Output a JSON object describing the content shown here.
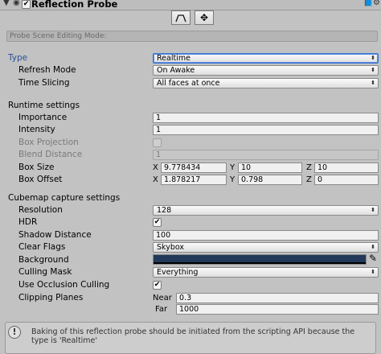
{
  "header": {
    "title": "Reflection Probe"
  },
  "scene_mode": {
    "placeholder": "Probe Scene Editing Mode:"
  },
  "props": {
    "type": {
      "label": "Type",
      "value": "Realtime"
    },
    "refresh_mode": {
      "label": "Refresh Mode",
      "value": "On Awake"
    },
    "time_slicing": {
      "label": "Time Slicing",
      "value": "All faces at once"
    }
  },
  "runtime": {
    "header": "Runtime settings",
    "importance": {
      "label": "Importance",
      "value": "1"
    },
    "intensity": {
      "label": "Intensity",
      "value": "1"
    },
    "box_projection": {
      "label": "Box Projection"
    },
    "blend_distance": {
      "label": "Blend Distance",
      "value": "1"
    },
    "box_size": {
      "label": "Box Size",
      "x": "9.778434",
      "y": "10",
      "z": "10"
    },
    "box_offset": {
      "label": "Box Offset",
      "x": "1.878217",
      "y": "0.798",
      "z": "0"
    }
  },
  "axes": {
    "x": "X",
    "y": "Y",
    "z": "Z"
  },
  "cubemap": {
    "header": "Cubemap capture settings",
    "resolution": {
      "label": "Resolution",
      "value": "128"
    },
    "hdr": {
      "label": "HDR",
      "checked": true
    },
    "shadow_distance": {
      "label": "Shadow Distance",
      "value": "100"
    },
    "clear_flags": {
      "label": "Clear Flags",
      "value": "Skybox"
    },
    "background": {
      "label": "Background",
      "color": "#22395a"
    },
    "culling_mask": {
      "label": "Culling Mask",
      "value": "Everything"
    },
    "occlusion": {
      "label": "Use Occlusion Culling",
      "checked": true
    },
    "clipping": {
      "label": "Clipping Planes",
      "near_label": "Near",
      "near": "0.3",
      "far_label": "Far",
      "far": "1000"
    }
  },
  "help": {
    "text": "Baking of this reflection probe should be initiated from the scripting API because the type is 'Realtime'"
  }
}
